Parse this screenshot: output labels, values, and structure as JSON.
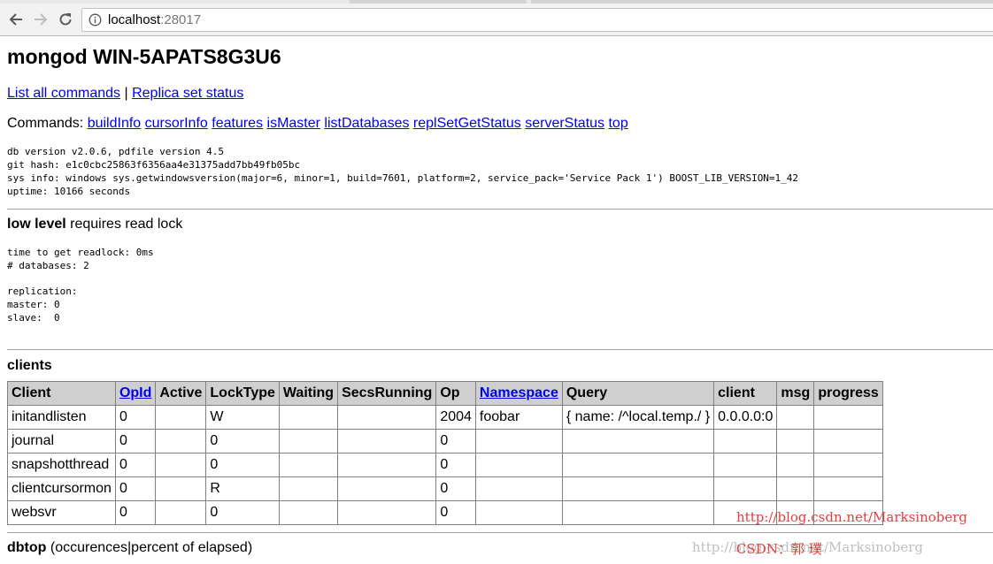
{
  "browser": {
    "url_host": "localhost",
    "url_port": ":28017"
  },
  "page": {
    "title": "mongod WIN-5APATS8G3U6",
    "links": [
      "List all commands",
      "Replica set status"
    ],
    "link_separator": " | ",
    "commands_label": "Commands: ",
    "commands": [
      "buildInfo",
      "cursorInfo",
      "features",
      "isMaster",
      "listDatabases",
      "replSetGetStatus",
      "serverStatus",
      "top"
    ],
    "info_lines": [
      "db version v2.0.6, pdfile version 4.5",
      "git hash: e1c0cbc25863f6356aa4e31375add7bb49fb05bc",
      "sys info: windows sys.getwindowsversion(major=6, minor=1, build=7601, platform=2, service_pack='Service Pack 1') BOOST_LIB_VERSION=1_42",
      "uptime: 10166 seconds"
    ],
    "low_level": {
      "bold": "low level",
      "rest": " requires read lock"
    },
    "lock_lines": [
      "time to get readlock: 0ms",
      "# databases: 2"
    ],
    "replication_lines": [
      "replication:",
      "master: 0",
      "slave:  0"
    ],
    "clients_heading": "clients",
    "clients_table": {
      "headers": [
        {
          "text": "Client",
          "link": false
        },
        {
          "text": "OpId",
          "link": true
        },
        {
          "text": "Active",
          "link": false
        },
        {
          "text": "LockType",
          "link": false
        },
        {
          "text": "Waiting",
          "link": false
        },
        {
          "text": "SecsRunning",
          "link": false
        },
        {
          "text": "Op",
          "link": false
        },
        {
          "text": "Namespace",
          "link": true
        },
        {
          "text": "Query",
          "link": false
        },
        {
          "text": "client",
          "link": false
        },
        {
          "text": "msg",
          "link": false
        },
        {
          "text": "progress",
          "link": false
        }
      ],
      "rows": [
        [
          "initandlisten",
          "0",
          "",
          "W",
          "",
          "",
          "2004",
          "foobar",
          "{ name: /^local.temp./ }",
          "0.0.0.0:0",
          "",
          ""
        ],
        [
          "journal",
          "0",
          "",
          "0",
          "",
          "",
          "0",
          "",
          "",
          "",
          "",
          ""
        ],
        [
          "snapshotthread",
          "0",
          "",
          "0",
          "",
          "",
          "0",
          "",
          "",
          "",
          "",
          ""
        ],
        [
          "clientcursormon",
          "0",
          "",
          "R",
          "",
          "",
          "0",
          "",
          "",
          "",
          "",
          ""
        ],
        [
          "websvr",
          "0",
          "",
          "0",
          "",
          "",
          "0",
          "",
          "",
          "",
          "",
          ""
        ]
      ]
    },
    "dbtop": {
      "bold": "dbtop",
      "rest": " (occurences|percent of elapsed)"
    }
  },
  "watermark": {
    "line1": "http://blog.csdn.net/Marksinoberg",
    "line2_grey": "http://blog.csdn.net/Marksinoberg",
    "line2_red": "CSDN：郭  璞"
  }
}
